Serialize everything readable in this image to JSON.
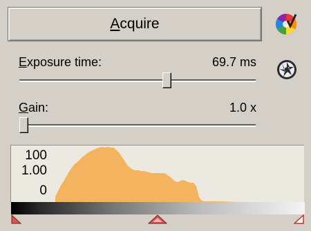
{
  "acquire": {
    "label_first": "A",
    "label_rest": "cquire"
  },
  "exposure": {
    "label_first": "E",
    "label_rest": "xposure time:",
    "value": "69.7 ms",
    "slider_fraction": 0.63
  },
  "gain": {
    "label_first": "G",
    "label_rest": "ain:",
    "value": "1.0 x",
    "slider_fraction": 0.0
  },
  "histogram": {
    "label_top": "100",
    "label_mid": "1.00",
    "label_bottom": "0",
    "fill_color": "#f4b35e"
  },
  "icons": {
    "color_wheel": "color-wheel-icon",
    "aperture": "aperture-icon"
  },
  "markers": {
    "black_point": "triangle-marker",
    "gamma": "triangle-marker",
    "white_point": "triangle-marker"
  }
}
